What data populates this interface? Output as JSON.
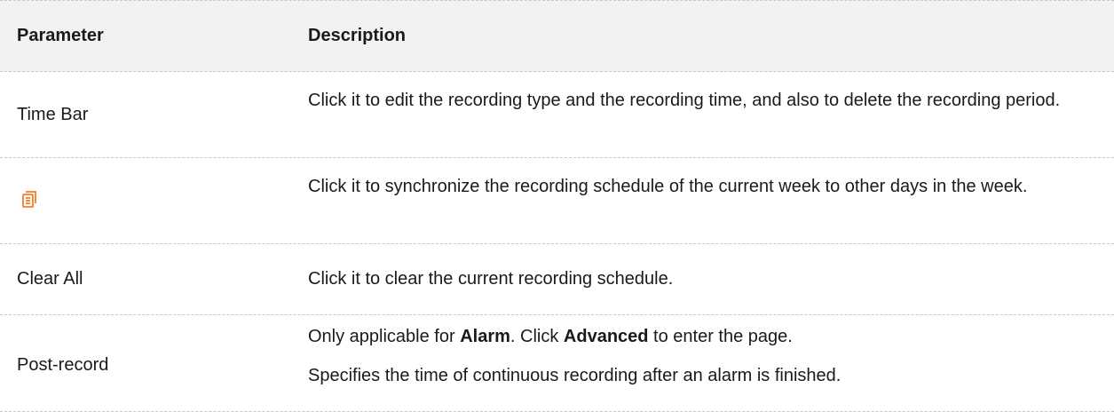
{
  "table": {
    "headers": [
      "Parameter",
      "Description"
    ],
    "rows": [
      {
        "parameter": "Time Bar",
        "description": "Click it to edit the recording type and the recording time, and also to delete the recording period."
      },
      {
        "parameter_icon": "copy-schedule-icon",
        "parameter_icon_color": "#f57c28",
        "description": "Click it to synchronize the recording schedule of the current week to other days in the week."
      },
      {
        "parameter": "Clear All",
        "description": "Click it to clear the current recording schedule."
      },
      {
        "parameter": "Post-record",
        "description_parts": [
          "Only applicable for ",
          "Alarm",
          ". Click ",
          "Advanced",
          " to enter the page."
        ],
        "description_line2": "Specifies the time of continuous recording after an alarm is finished."
      }
    ]
  }
}
